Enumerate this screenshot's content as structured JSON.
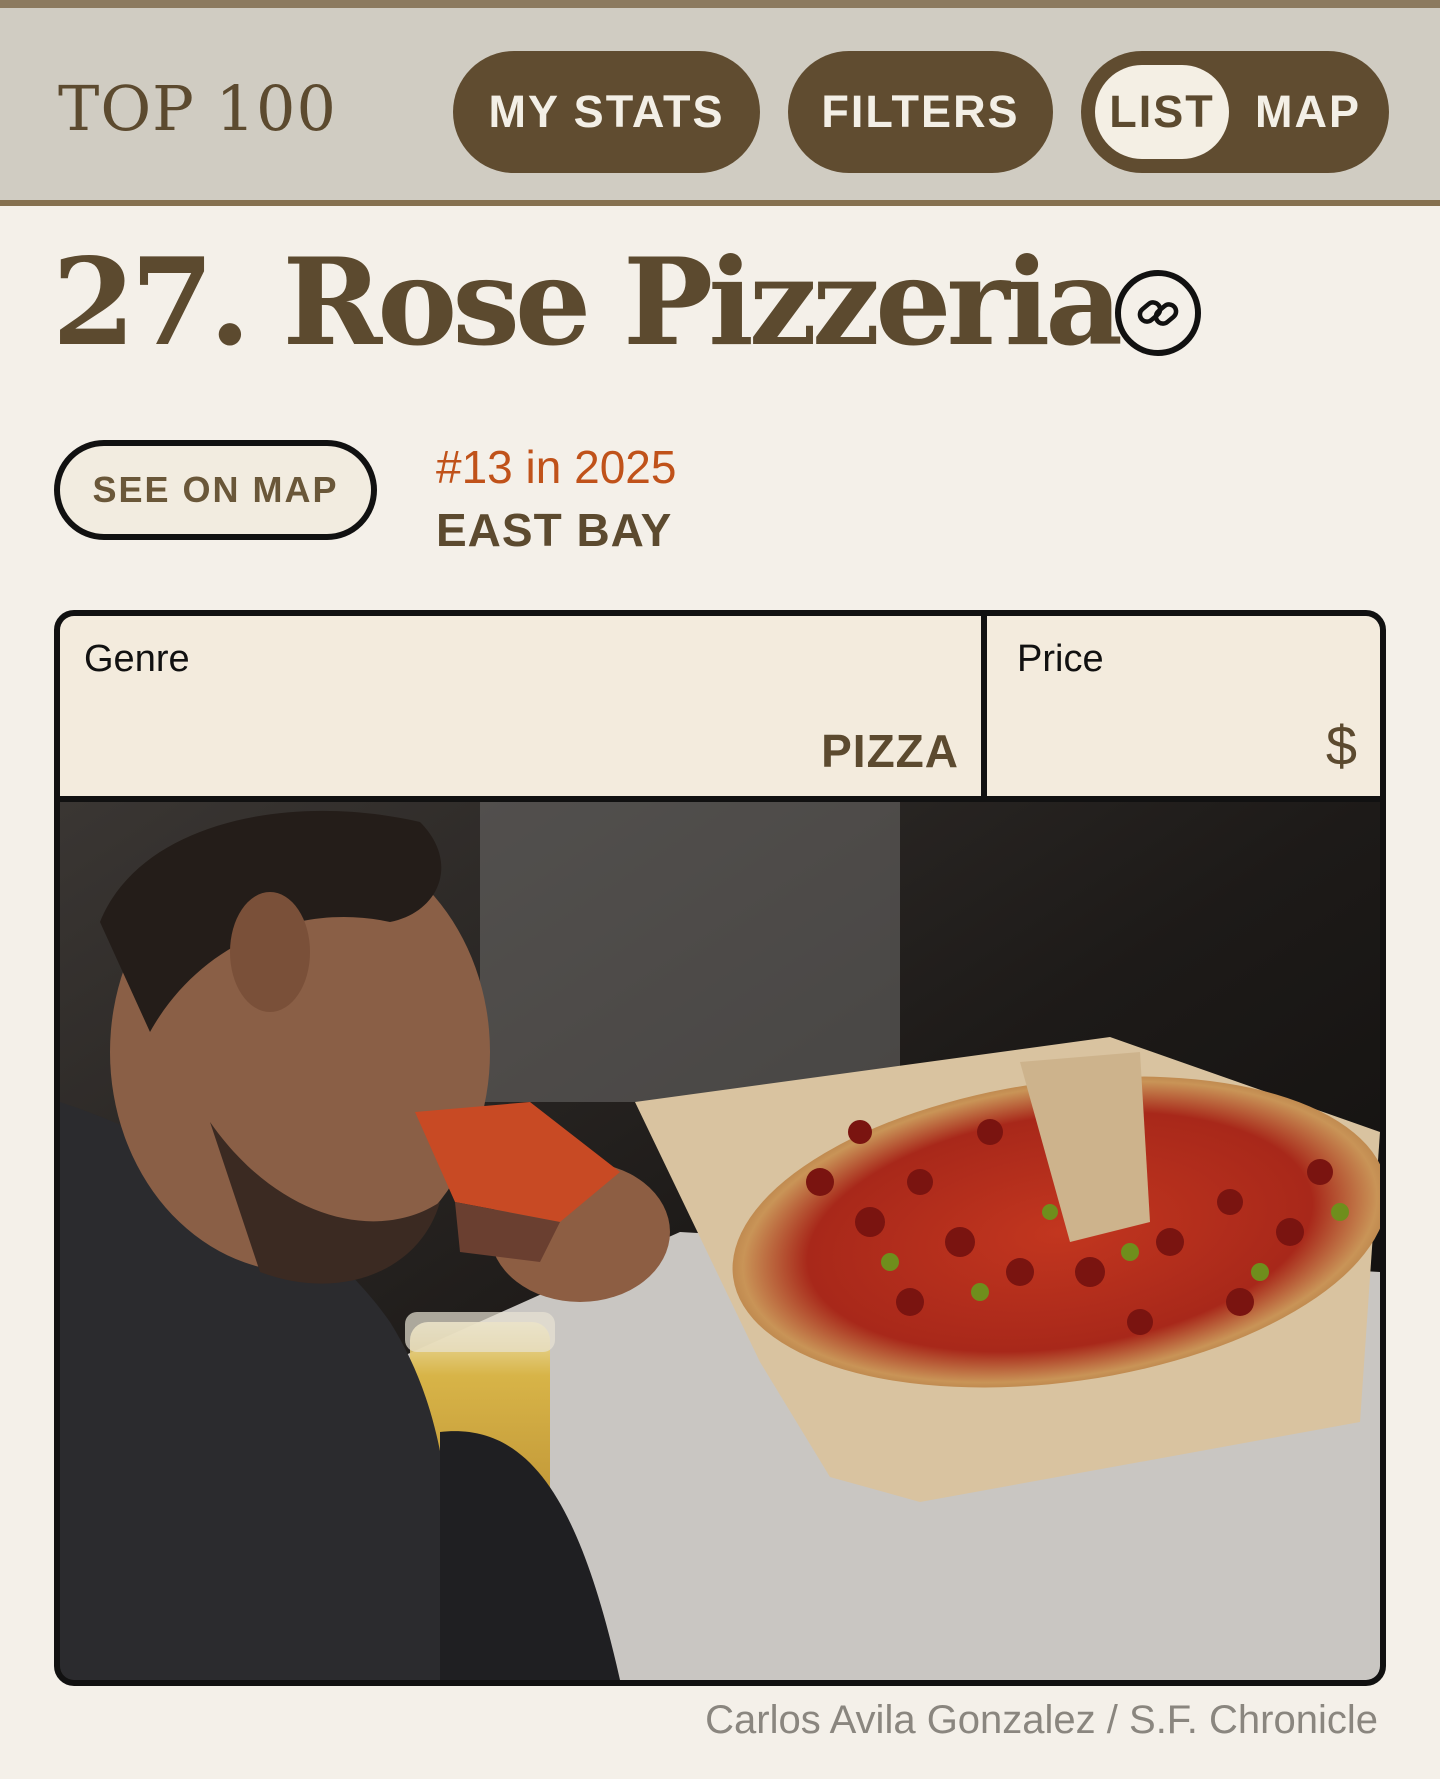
{
  "nav": {
    "logo": "TOP 100",
    "my_stats": "MY STATS",
    "filters": "FILTERS",
    "view_toggle": {
      "list": "LIST",
      "map": "MAP",
      "selected": "LIST"
    }
  },
  "restaurant": {
    "title": "27. Rose Pizzeria",
    "see_on_map": "SEE ON MAP",
    "previous_rank": "#13 in 2025",
    "region": "EAST BAY",
    "genre_label": "Genre",
    "genre": "PIZZA",
    "price_label": "Price",
    "price": "$"
  },
  "photo": {
    "credit": "Carlos Avila Gonzalez / S.F. Chronicle"
  },
  "colors": {
    "brand_brown": "#604c30",
    "page_bg": "#f4f0e9",
    "nav_bg": "#d0ccc2",
    "rank_orange": "#c0521a"
  },
  "icons": [
    "link-icon"
  ]
}
